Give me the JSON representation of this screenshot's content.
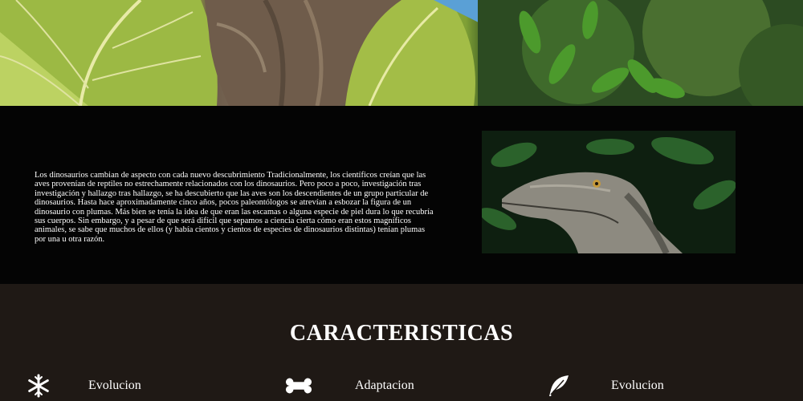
{
  "hero": {
    "image": "dinosaur-jungle-hero-photo"
  },
  "intro": {
    "paragraph": "Los dinosaurios cambian de aspecto con cada nuevo descubrimiento Tradicionalmente, los científicos creían que las aves provenían de reptiles no estrechamente relacionados con los dinosaurios. Pero poco a poco, investigación tras investigación y hallazgo tras hallazgo, se ha descubierto que las aves son los descendientes de un grupo particular de dinosaurios. Hasta hace aproximadamente cinco años, pocos paleontólogos se atrevían a esbozar la figura de un dinosaurio con plumas. Más bien se tenía la idea de que eran las escamas o alguna especie de piel dura lo que recubría sus cuerpos. Sin embargo, y a pesar de que será difícil que sepamos a ciencia cierta cómo eran estos magníficos animales, se sabe que muchos de ellos (y había cientos y cientos de especies de dinosaurios distintas) tenían plumas por una u otra razón.",
    "photo": "raptor-head-photo"
  },
  "features": {
    "title": "CARACTERISTICAS",
    "items": [
      {
        "icon": "snowflake-icon",
        "label": "Evolucion"
      },
      {
        "icon": "bone-icon",
        "label": "Adaptacion"
      },
      {
        "icon": "feather-icon",
        "label": "Evolucion"
      }
    ]
  },
  "colors": {
    "intro_bg": "#040404",
    "features_bg": "#1f1915",
    "text": "#ffffff"
  }
}
